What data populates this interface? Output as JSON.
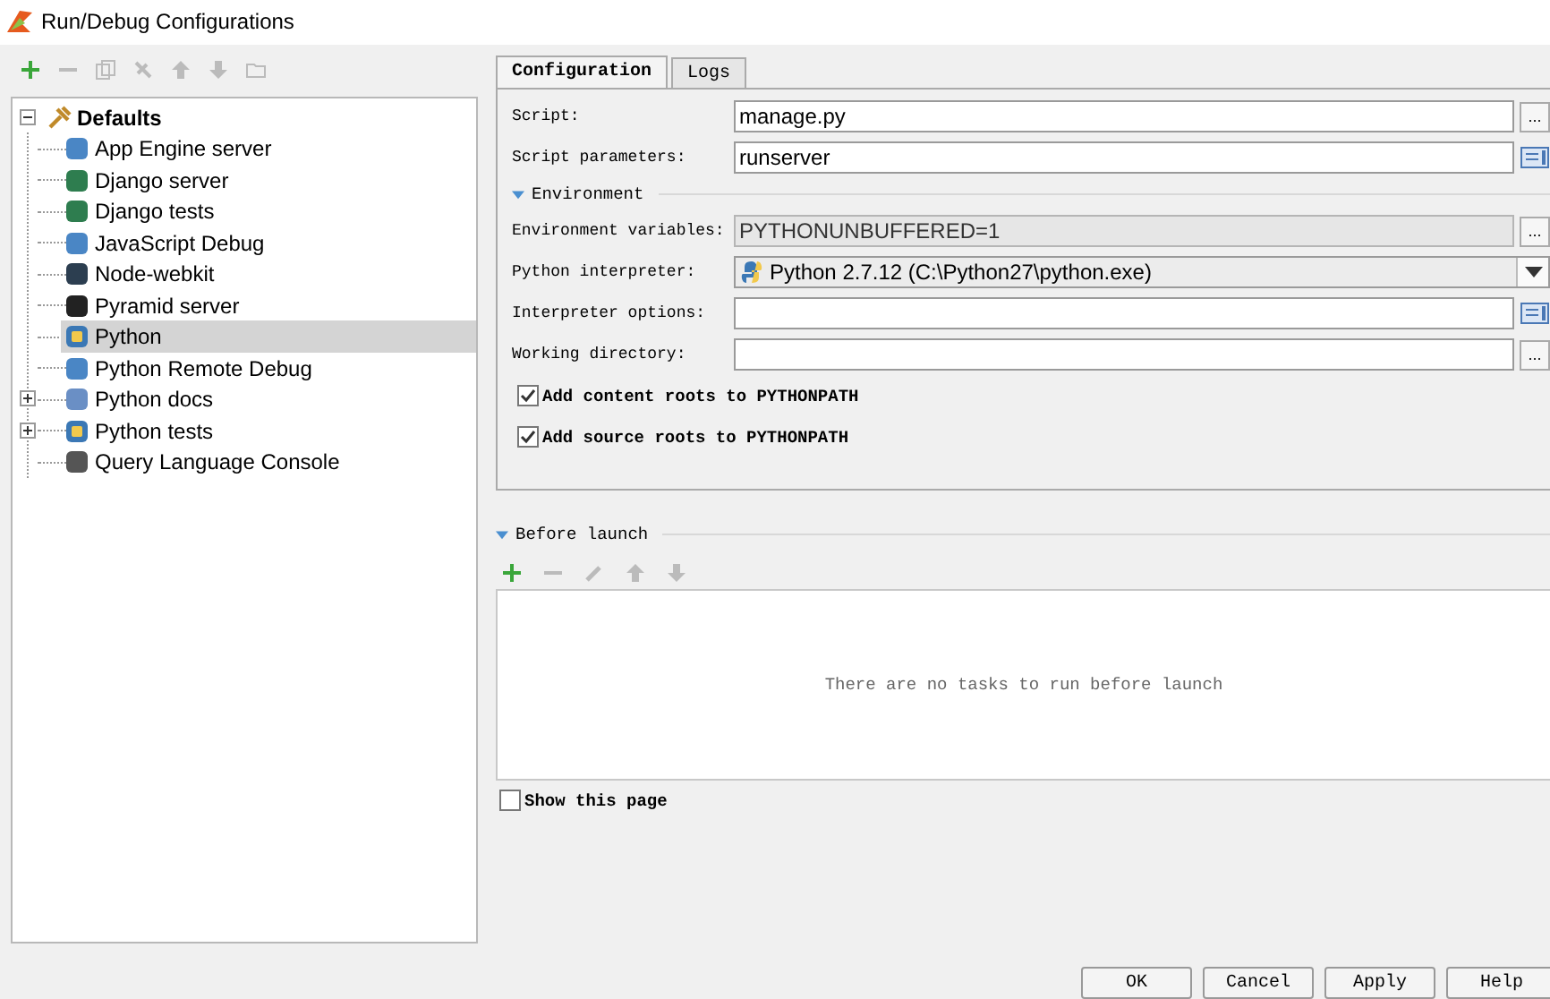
{
  "window": {
    "title": "Run/Debug Configurations"
  },
  "tree": {
    "items": [
      {
        "label": "Defaults",
        "expanded": true,
        "selected": false,
        "children": [
          {
            "label": "App Engine server",
            "selected": false
          },
          {
            "label": "Django server",
            "selected": false
          },
          {
            "label": "Django tests",
            "selected": false
          },
          {
            "label": "JavaScript Debug",
            "selected": false
          },
          {
            "label": "Node-webkit",
            "selected": false
          },
          {
            "label": "Pyramid server",
            "selected": false
          },
          {
            "label": "Python",
            "selected": true
          },
          {
            "label": "Python Remote Debug",
            "selected": false
          },
          {
            "label": "Python docs",
            "selected": false,
            "expanded": false
          },
          {
            "label": "Python tests",
            "selected": false,
            "expanded": false
          },
          {
            "label": "Query Language Console",
            "selected": false
          }
        ]
      }
    ]
  },
  "tabs": [
    {
      "label": "Configuration",
      "selected": true
    },
    {
      "label": "Logs",
      "selected": false
    }
  ],
  "fields": [
    {
      "label": "Script:",
      "value": "manage.py",
      "kind": "text",
      "readonly": false,
      "button": {
        "kind": "browse",
        "text": "..."
      }
    },
    {
      "label": "Script parameters:",
      "value": "runserver",
      "kind": "text",
      "readonly": false,
      "button": {
        "kind": "expand"
      }
    }
  ],
  "environment": {
    "title": "Environment",
    "expanded": true,
    "fields": [
      {
        "label": "Environment variables:",
        "value": "PYTHONUNBUFFERED=1",
        "kind": "text",
        "readonly": true,
        "button": {
          "kind": "browse",
          "text": "..."
        }
      },
      {
        "label": "Python interpreter:",
        "value": "Python 2.7.12 (C:\\Python27\\python.exe)",
        "kind": "dropdown"
      },
      {
        "label": "Interpreter options:",
        "kind": "text",
        "readonly": false,
        "button": {
          "kind": "expand"
        }
      },
      {
        "label": "Working directory:",
        "kind": "text",
        "readonly": false,
        "button": {
          "kind": "browse",
          "text": "..."
        }
      }
    ],
    "checkboxes": [
      {
        "label": "Add content roots to PYTHONPATH",
        "checked": true
      },
      {
        "label": "Add source roots to PYTHONPATH",
        "checked": true
      }
    ]
  },
  "before_launch": {
    "title": "Before launch",
    "expanded": true,
    "empty_text": "There are no tasks to run before launch"
  },
  "show_page": {
    "label": "Show this page",
    "checked": false
  },
  "buttons": [
    {
      "label": "OK"
    },
    {
      "label": "Cancel"
    },
    {
      "label": "Apply"
    },
    {
      "label": "Help"
    }
  ]
}
